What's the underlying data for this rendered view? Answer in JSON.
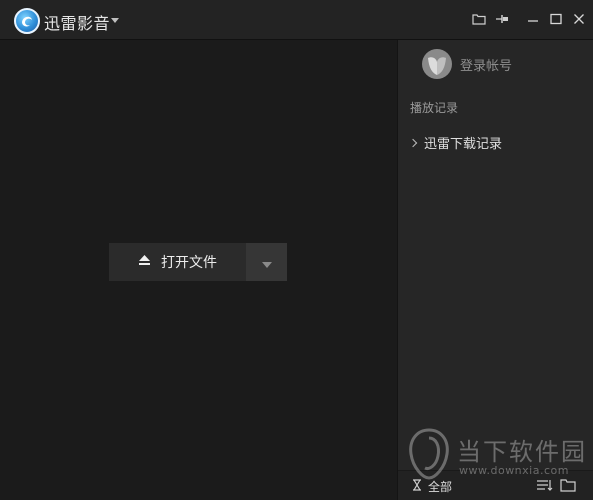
{
  "app": {
    "title": "迅雷影音"
  },
  "titlebar": {
    "icons": [
      "folder-icon",
      "pin-icon",
      "minimize-icon",
      "maximize-icon",
      "close-icon"
    ]
  },
  "player": {
    "open_file_label": "打开文件",
    "open_icon": "eject-icon",
    "dropdown_icon": "caret-down-icon"
  },
  "sidebar": {
    "login_label": "登录帐号",
    "history_title": "播放记录",
    "history_items": [
      {
        "label": "迅雷下载记录"
      }
    ],
    "filter_label": "全部"
  },
  "watermark": {
    "brand": "当下软件园",
    "url": "www.downxia.com"
  },
  "colors": {
    "background": "#1b1b1b",
    "sidebar": "#262626",
    "button": "#2b2b2b",
    "accent_logo": "#2f8fd9"
  }
}
